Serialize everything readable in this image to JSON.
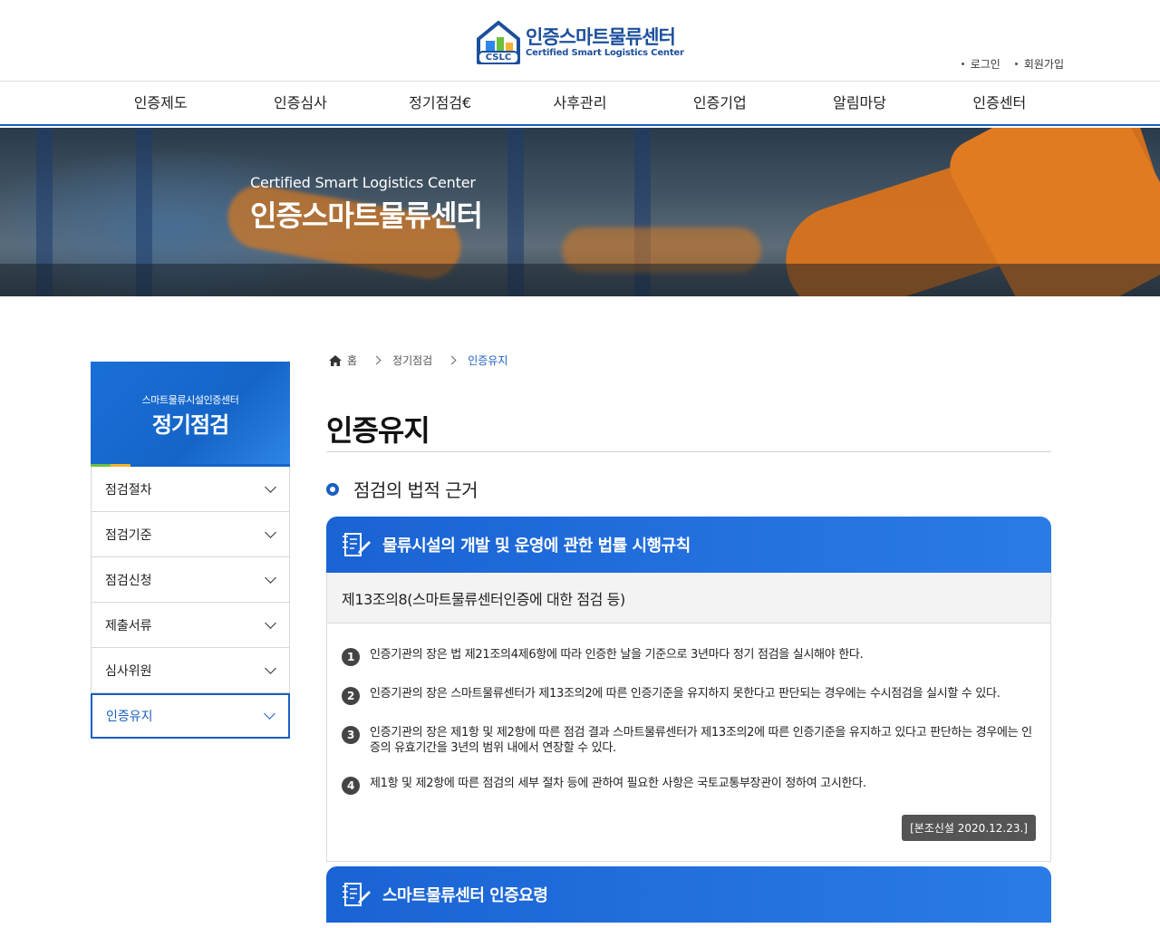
{
  "header": {
    "logo_ko": "인증스마트물류센터",
    "logo_en": "Certified Smart Logistics Center",
    "logo_badge": "CSLC",
    "util_links": [
      "로그인",
      "회원가입"
    ]
  },
  "gnb": [
    "인증제도",
    "인증심사",
    "정기점검€",
    "사후관리",
    "인증기업",
    "알림마당",
    "인증센터"
  ],
  "hero": {
    "subtitle": "Certified Smart Logistics Center",
    "title": "인증스마트물류센터"
  },
  "sidebar": {
    "eyebrow": "스마트물류시설인증센터",
    "title": "정기점검",
    "items": [
      {
        "label": "점검절차",
        "active": false
      },
      {
        "label": "점검기준",
        "active": false
      },
      {
        "label": "점검신청",
        "active": false
      },
      {
        "label": "제출서류",
        "active": false
      },
      {
        "label": "심사위원",
        "active": false
      },
      {
        "label": "인증유지",
        "active": true
      }
    ]
  },
  "breadcrumb": [
    "홈",
    "정기점검",
    "인증유지"
  ],
  "page_title": "인증유지",
  "section_title": "점검의 법적 근거",
  "box1": {
    "head": "물류시설의 개발 및 운영에 관한 법률 시행규칙",
    "sub": "제13조의8(스마트물류센터인증에 대한 점검 등)",
    "items": [
      {
        "num": "1",
        "text": "인증기관의 장은 법 제21조의4제6항에 따라 인증한 날을 기준으로 3년마다 정기 점검을 실시해야 한다."
      },
      {
        "num": "2",
        "text": "인증기관의 장은 스마트물류센터가 제13조의2에 따른 인증기준을 유지하지 못한다고 판단되는 경우에는 수시점검을 실시할 수 있다."
      },
      {
        "num": "3",
        "text": "인증기관의 장은 제1항 및 제2항에 따른 점검 결과 스마트물류센터가 제13조의2에 따른 인증기준을 유지하고 있다고 판단하는 경우에는 인증의 유효기간을 3년의 범위 내에서 연장할 수 있다."
      },
      {
        "num": "4",
        "text": "제1항 및 제2항에 따른 점검의 세부 절차 등에 관하여 필요한 사항은 국토교통부장관이 정하여 고시한다."
      }
    ],
    "badge": "[본조신설 2020.12.23.]"
  },
  "box2": {
    "head": "스마트물류센터 인증요령"
  },
  "colors": {
    "primary": "#1a5fc2",
    "hero_orange": "#e07b22"
  }
}
